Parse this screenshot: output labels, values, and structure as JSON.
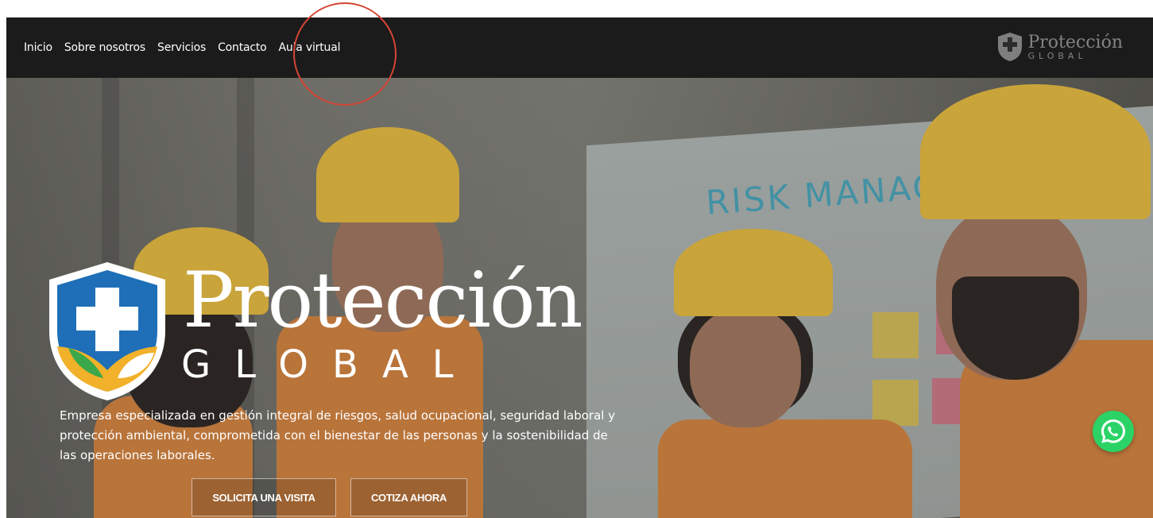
{
  "nav": {
    "links": [
      "Inicio",
      "Sobre nosotros",
      "Servicios",
      "Contacto",
      "Aula virtual"
    ],
    "logo_name": "Protección",
    "logo_sub": "GLOBAL"
  },
  "hero": {
    "brand_title": "Protección",
    "brand_sub": "GLOBAL",
    "description": "Empresa especializada en gestión integral de riesgos, salud ocupacional, seguridad laboral y protección ambiental, comprometida con el bienestar de las personas y la sostenibilidad de las operaciones laborales.",
    "buttons": {
      "visit": "SOLICITA UNA VISITA",
      "quote": "COTIZA AHORA"
    },
    "whiteboard_text": "RISK  MANAGEM"
  },
  "colors": {
    "nav_bg": "#1b1b1b",
    "annotation": "#d64535",
    "whatsapp": "#2bd366",
    "shield_blue": "#1e6fb8",
    "shield_green": "#3aa84a",
    "shield_yellow": "#f2b12a"
  },
  "icons": {
    "nav_logo": "shield-cross-icon",
    "hero_logo": "shield-cross-icon",
    "chat": "whatsapp-icon"
  }
}
